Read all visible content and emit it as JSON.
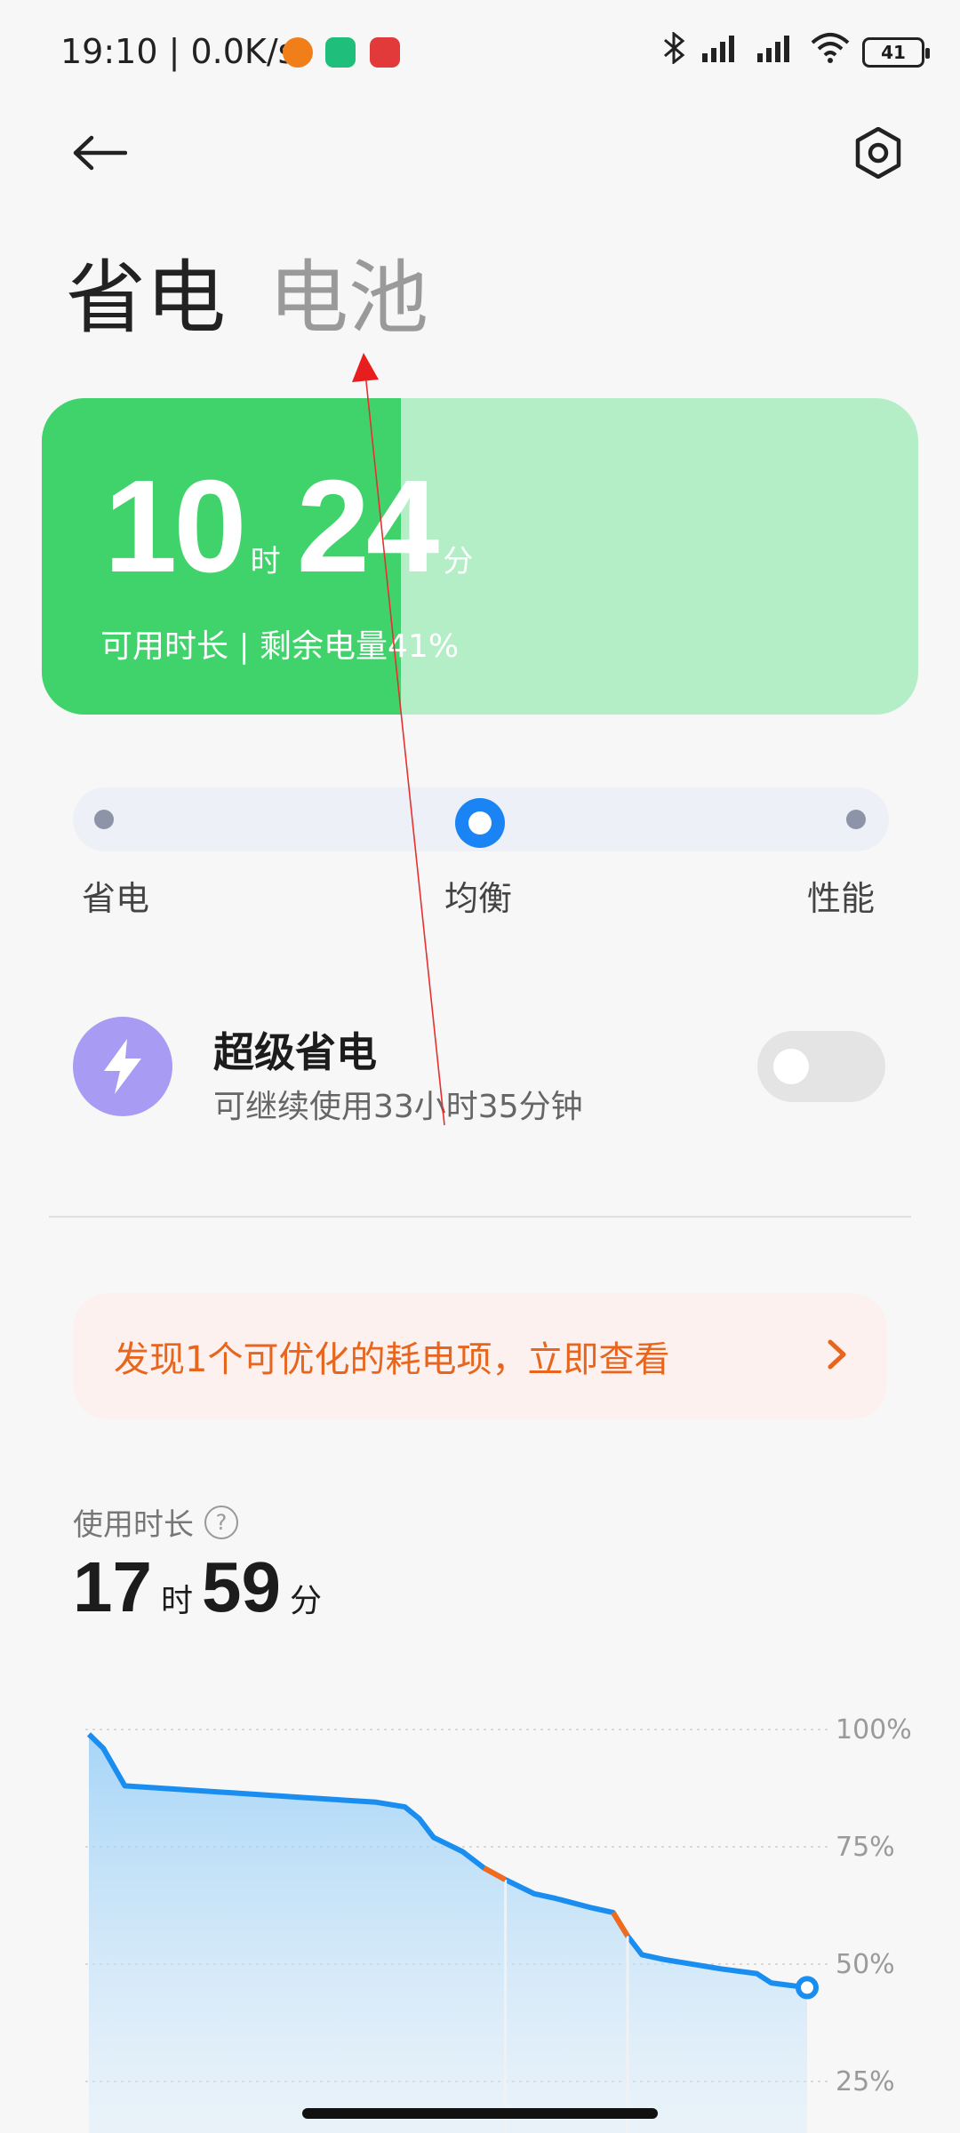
{
  "status_bar": {
    "time": "19:10",
    "network_speed": "0.0K/s",
    "battery": "41",
    "icons": [
      "bluetooth-icon",
      "signal-hd-icon",
      "signal-hd-icon",
      "wifi-icon"
    ]
  },
  "header": {
    "tab_power_saving": "省电",
    "tab_battery": "电池"
  },
  "battery_card": {
    "hours": "10",
    "hours_unit": "时",
    "minutes": "24",
    "minutes_unit": "分",
    "subtitle": "可用时长 | 剩余电量41%",
    "fill_percent": 41,
    "color_fill": "#41d36b",
    "color_bg": "#b4eec7"
  },
  "mode_selector": {
    "options": [
      "省电",
      "均衡",
      "性能"
    ],
    "selected": "均衡"
  },
  "super_saver": {
    "title": "超级省电",
    "subtitle": "可继续使用33小时35分钟",
    "enabled": false
  },
  "optimize_banner": {
    "text": "发现1个可优化的耗电项，立即查看",
    "color": "#e8651e"
  },
  "usage": {
    "label": "使用时长",
    "hours": "17",
    "hours_unit": "时",
    "minutes": "59",
    "minutes_unit": "分"
  },
  "chart_data": {
    "type": "area",
    "y_ticks": [
      "100%",
      "75%",
      "50%",
      "25%"
    ],
    "ylim": [
      25,
      100
    ],
    "x": [
      0,
      2,
      5,
      10,
      20,
      30,
      40,
      44,
      46,
      48,
      52,
      55,
      58,
      62,
      65,
      70,
      73,
      75,
      77,
      80,
      88,
      93,
      95,
      100
    ],
    "values": [
      99,
      96,
      88,
      87.5,
      86.5,
      85.5,
      84.5,
      83.5,
      81,
      77,
      74,
      70.5,
      68,
      65,
      64,
      62,
      61,
      56,
      52,
      51,
      49,
      48,
      46,
      45
    ],
    "charging_segments": [
      [
        55,
        58
      ],
      [
        73,
        75
      ]
    ],
    "line_color": "#1a8ef0",
    "charging_color": "#f26a1b",
    "grid": true
  }
}
